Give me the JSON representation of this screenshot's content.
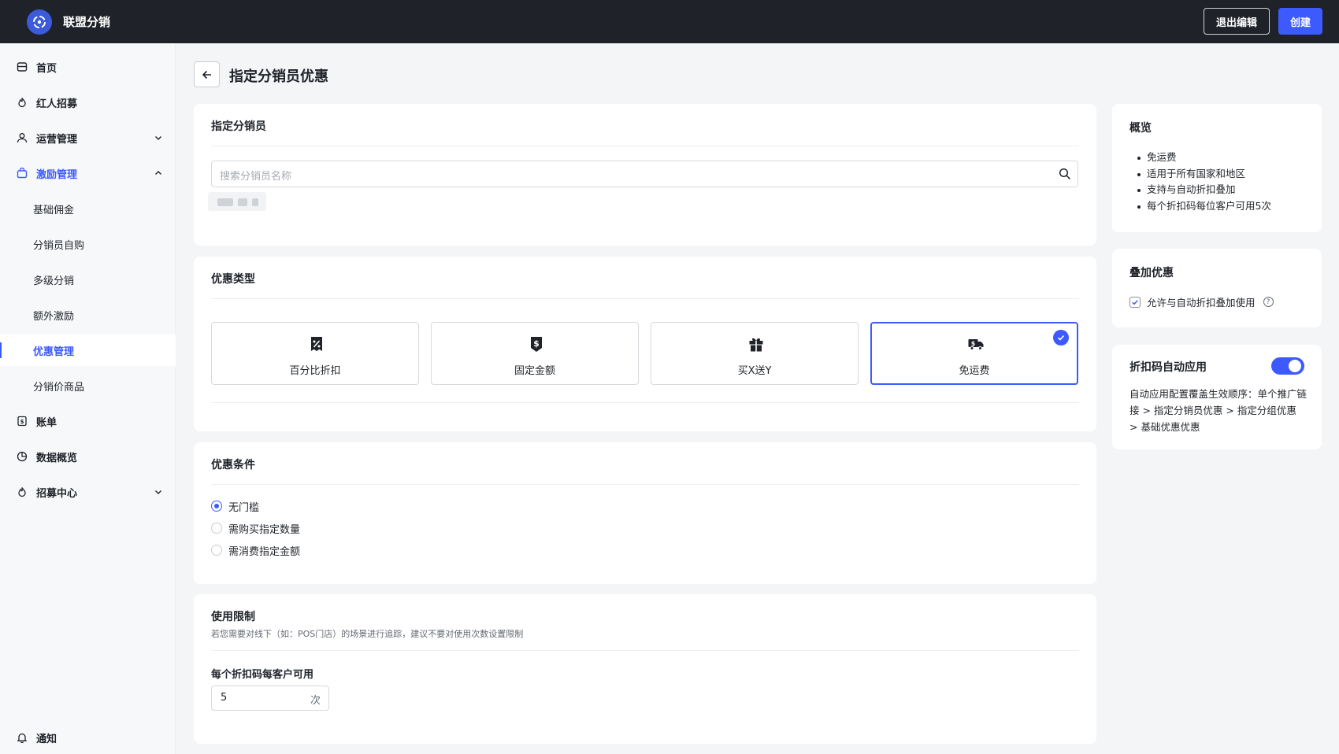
{
  "app": {
    "title": "联盟分销"
  },
  "header": {
    "exit_label": "退出编辑",
    "create_label": "创建",
    "accent": "#3d5afe"
  },
  "sidebar": {
    "items": [
      {
        "label": "首页",
        "icon": "store-icon"
      },
      {
        "label": "红人招募",
        "icon": "flame-icon"
      },
      {
        "label": "运营管理",
        "icon": "user-icon"
      },
      {
        "label": "激励管理",
        "icon": "bag-icon"
      },
      {
        "label": "基础佣金"
      },
      {
        "label": "分销员自购"
      },
      {
        "label": "多级分销"
      },
      {
        "label": "额外激励"
      },
      {
        "label": "优惠管理"
      },
      {
        "label": "分销价商品"
      },
      {
        "label": "账单",
        "icon": "bill-icon"
      },
      {
        "label": "数据概览",
        "icon": "pie-chart-icon"
      },
      {
        "label": "招募中心",
        "icon": "flame-icon"
      }
    ],
    "notify_label": "通知"
  },
  "page": {
    "title": "指定分销员优惠"
  },
  "distributor": {
    "title": "指定分销员",
    "search_placeholder": "搜索分销员名称"
  },
  "discount_type": {
    "title": "优惠类型",
    "options": [
      "百分比折扣",
      "固定金额",
      "买X送Y",
      "免运费"
    ],
    "selected": "免运费"
  },
  "conditions": {
    "title": "优惠条件",
    "options": [
      "无门槛",
      "需购买指定数量",
      "需消费指定金额"
    ],
    "selected": "无门槛"
  },
  "limits": {
    "title": "使用限制",
    "hint": "若您需要对线下（如：POS门店）的场景进行追踪，建议不要对使用次数设置限制",
    "field_label": "每个折扣码每客户可用",
    "value": "5",
    "unit": "次"
  },
  "overview": {
    "title": "概览",
    "items": [
      "免运费",
      "适用于所有国家和地区",
      "支持与自动折扣叠加",
      "每个折扣码每位客户可用5次"
    ]
  },
  "stacking": {
    "title": "叠加优惠",
    "checkbox_label": "允许与自动折扣叠加使用",
    "checked": true
  },
  "auto_apply": {
    "title": "折扣码自动应用",
    "enabled": true,
    "description": "自动应用配置覆盖生效顺序：单个推广链接 > 指定分销员优惠 > 指定分组优惠 > 基础优惠优惠"
  }
}
